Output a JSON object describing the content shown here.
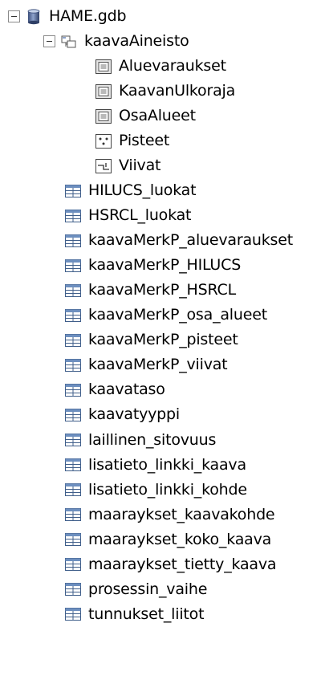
{
  "tree": {
    "root": {
      "label": "HAME.gdb",
      "icon": "geodatabase-icon",
      "expanded": true
    },
    "dataset": {
      "label": "kaavaAineisto",
      "icon": "feature-dataset-icon",
      "expanded": true,
      "children": [
        {
          "label": "Aluevaraukset",
          "icon": "polygon-feature-class-icon"
        },
        {
          "label": "KaavanUlkoraja",
          "icon": "polygon-feature-class-icon"
        },
        {
          "label": "OsaAlueet",
          "icon": "polygon-feature-class-icon"
        },
        {
          "label": "Pisteet",
          "icon": "point-feature-class-icon"
        },
        {
          "label": "Viivat",
          "icon": "line-feature-class-icon"
        }
      ]
    },
    "tables": [
      "HILUCS_luokat",
      "HSRCL_luokat",
      "kaavaMerkP_aluevaraukset",
      "kaavaMerkP_HILUCS",
      "kaavaMerkP_HSRCL",
      "kaavaMerkP_osa_alueet",
      "kaavaMerkP_pisteet",
      "kaavaMerkP_viivat",
      "kaavataso",
      "kaavatyyppi",
      "laillinen_sitovuus",
      "lisatieto_linkki_kaava",
      "lisatieto_linkki_kohde",
      "maaraykset_kaavakohde",
      "maaraykset_koko_kaava",
      "maaraykset_tietty_kaava",
      "prosessin_vaihe",
      "tunnukset_liitot"
    ],
    "table_icon": "table-icon"
  }
}
